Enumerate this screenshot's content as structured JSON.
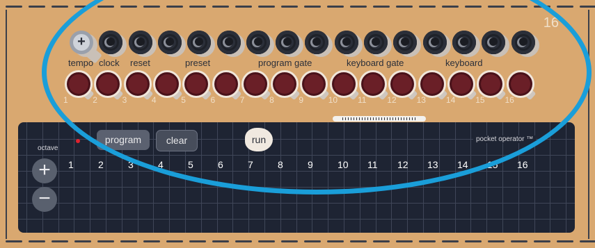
{
  "corner_number": "16",
  "jack_labels": [
    "tempo",
    "clock",
    "reset",
    "preset",
    "program gate",
    "keyboard gate",
    "keyboard"
  ],
  "knob_numbers": [
    "1",
    "2",
    "3",
    "4",
    "5",
    "6",
    "7",
    "8",
    "9",
    "10",
    "11",
    "12",
    "13",
    "14",
    "15",
    "16"
  ],
  "panel": {
    "octave_label": "octave",
    "plus": "+",
    "minus": "−",
    "program_label": "program",
    "clear_label": "clear",
    "run_label": "run",
    "brand_label": "pocket operator ™",
    "steps": [
      "1",
      "2",
      "3",
      "4",
      "5",
      "6",
      "7",
      "8",
      "9",
      "10",
      "11",
      "12",
      "13",
      "14",
      "15",
      "16"
    ]
  },
  "colors": {
    "body": "#d9a870",
    "panel": "#1e2433",
    "knob": "#6a1f27",
    "highlight_ellipse": "#1a9ed9",
    "led": "#e0232e"
  }
}
